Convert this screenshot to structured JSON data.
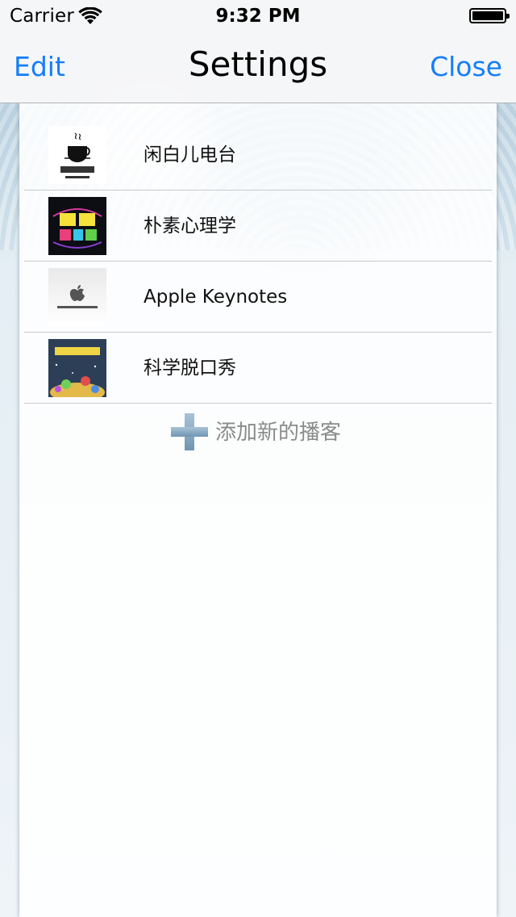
{
  "status_bar": {
    "carrier": "Carrier",
    "time": "9:32 PM"
  },
  "nav": {
    "edit_label": "Edit",
    "title": "Settings",
    "close_label": "Close"
  },
  "podcasts": [
    {
      "name": "闲白儿电台",
      "icon": "xianbaier-radio-artwork"
    },
    {
      "name": "朴素心理学",
      "icon": "pusu-psychology-artwork"
    },
    {
      "name": "Apple Keynotes",
      "icon": "apple-keynotes-artwork"
    },
    {
      "name": "科学脱口秀",
      "icon": "science-talk-show-artwork"
    }
  ],
  "add_podcast": {
    "label": "添加新的播客",
    "icon": "plus-icon"
  },
  "colors": {
    "accent": "#147efb",
    "separator": "#c8c8cc",
    "add_text": "#8a8a8a"
  }
}
